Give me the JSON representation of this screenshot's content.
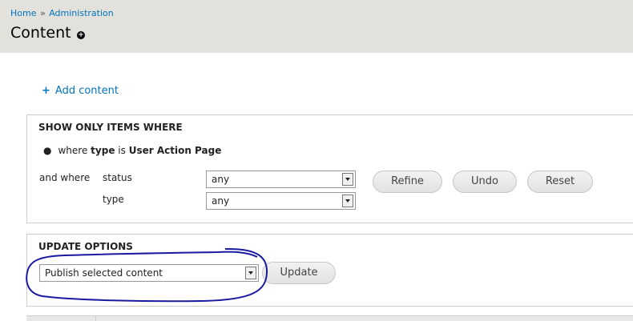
{
  "breadcrumb": {
    "home": "Home",
    "separator": "»",
    "admin": "Administration"
  },
  "page": {
    "title": "Content"
  },
  "actions": {
    "add_content": "Add content"
  },
  "filters": {
    "legend": "SHOW ONLY ITEMS WHERE",
    "criteria": {
      "prefix": "where",
      "field": "type",
      "is": "is",
      "value": "User Action Page"
    },
    "and_where": "and where",
    "status_label": "status",
    "status_value": "any",
    "type_label": "type",
    "type_value": "any",
    "refine": "Refine",
    "undo": "Undo",
    "reset": "Reset"
  },
  "update_options": {
    "legend": "UPDATE OPTIONS",
    "selected": "Publish selected content",
    "update": "Update"
  },
  "colors": {
    "link": "#0074bd",
    "header_bg": "#e2e1dc",
    "annotation": "#1a1aa0"
  }
}
